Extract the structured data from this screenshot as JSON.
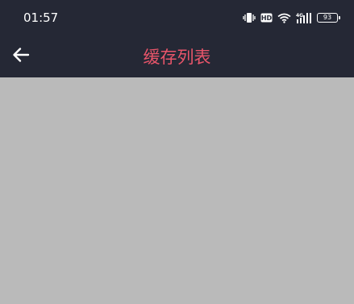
{
  "status_bar": {
    "time": "01:57",
    "icons": [
      "vibrate-icon",
      "hd-icon",
      "wifi-icon",
      "signal-4g-icon",
      "battery-icon"
    ],
    "network_label": "4G",
    "hd_label": "HD",
    "battery_level": "93"
  },
  "app_bar": {
    "back_icon": "back-arrow-icon",
    "title": "缓存列表"
  },
  "colors": {
    "header_background": "#252835",
    "title": "#e8556a",
    "content_background": "#bababa"
  }
}
